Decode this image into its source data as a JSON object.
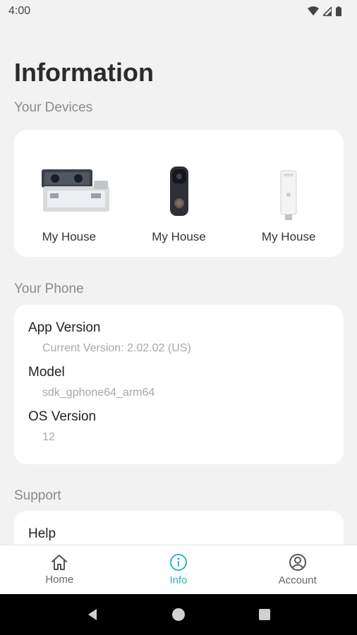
{
  "status_bar": {
    "time": "4:00"
  },
  "page_title": "Information",
  "devices_section": {
    "label": "Your Devices",
    "devices": [
      {
        "name": "My House",
        "icon": "stereo-camera-device-icon"
      },
      {
        "name": "My House",
        "icon": "video-doorbell-device-icon"
      },
      {
        "name": "My House",
        "icon": "plug-in-sensor-device-icon"
      }
    ]
  },
  "phone_section": {
    "label": "Your Phone",
    "app_version_label": "App Version",
    "app_version_value": "Current Version: 2.02.02 (US)",
    "model_label": "Model",
    "model_value": "sdk_gphone64_arm64",
    "os_label": "OS Version",
    "os_value": "12"
  },
  "support_section": {
    "label": "Support",
    "items": [
      "Help"
    ]
  },
  "bottom_nav": {
    "items": [
      {
        "label": "Home",
        "icon": "home-icon"
      },
      {
        "label": "Info",
        "icon": "info-icon"
      },
      {
        "label": "Account",
        "icon": "account-icon"
      }
    ],
    "active": "Info",
    "accent_color": "#2bb8c6"
  }
}
